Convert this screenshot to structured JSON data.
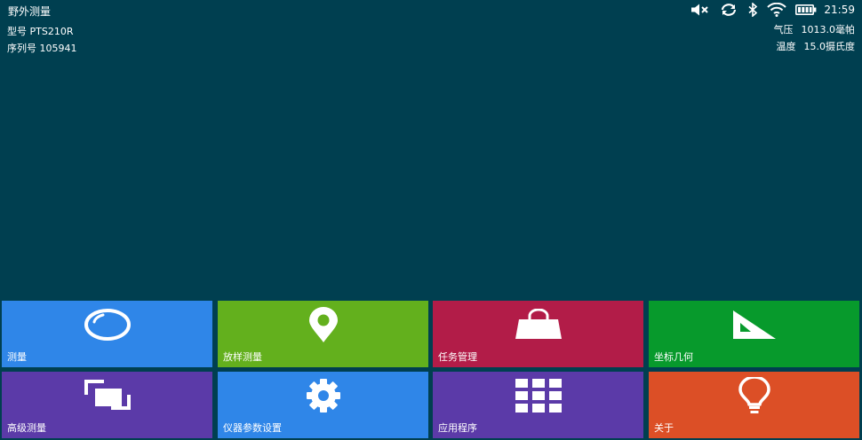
{
  "app": {
    "title": "野外测量"
  },
  "status": {
    "time": "21:59",
    "icons": [
      "mute-icon",
      "sync-icon",
      "bluetooth-icon",
      "wifi-icon",
      "battery-icon"
    ]
  },
  "device": {
    "model_label": "型号",
    "model_value": "PTS210R",
    "serial_label": "序列号",
    "serial_value": "105941",
    "pressure_label": "气压",
    "pressure_value": "1013.0毫帕",
    "temp_label": "温度",
    "temp_value": "15.0摄氏度"
  },
  "tiles": [
    {
      "label": "测量",
      "icon": "circle-icon",
      "color": "#2f86e8"
    },
    {
      "label": "放样测量",
      "icon": "location-pin-icon",
      "color": "#63b01d"
    },
    {
      "label": "任务管理",
      "icon": "shopping-bag-icon",
      "color": "#b21c48"
    },
    {
      "label": "坐标几何",
      "icon": "set-square-icon",
      "color": "#079a2c"
    },
    {
      "label": "高级测量",
      "icon": "copy-icon",
      "color": "#5b3aa8"
    },
    {
      "label": "仪器参数设置",
      "icon": "gear-icon",
      "color": "#2f86e8"
    },
    {
      "label": "应用程序",
      "icon": "grid-icon",
      "color": "#5b3aa8"
    },
    {
      "label": "关于",
      "icon": "lightbulb-icon",
      "color": "#dc4f26"
    }
  ]
}
